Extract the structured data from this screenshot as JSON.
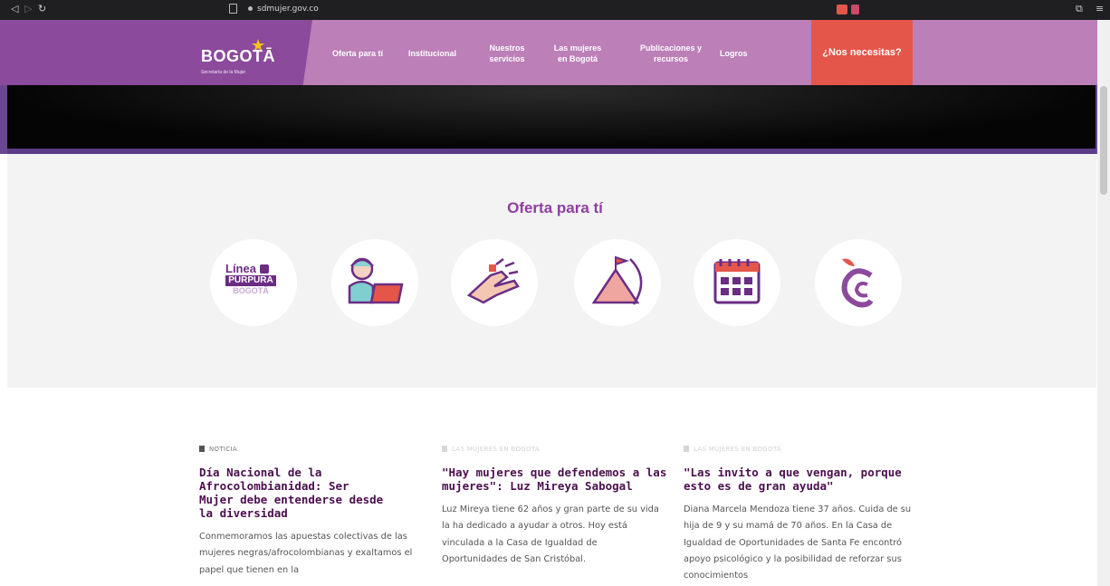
{
  "browser": {
    "url": "sdmujer.gov.co",
    "back_icon": "arrow-left-icon",
    "forward_icon": "arrow-right-icon",
    "reload_icon": "reload-icon"
  },
  "header": {
    "logo_text": "BOGOTĀ",
    "logo_subtext": "Secretaría de la Mujer",
    "nav": [
      {
        "label": "Oferta para tí"
      },
      {
        "label": "Institucional"
      },
      {
        "label": "Nuestros servicios"
      },
      {
        "label": "Las mujeres en Bogotá"
      },
      {
        "label": "Publicaciones y recursos"
      },
      {
        "label": "Logros"
      }
    ],
    "cta": "¿Nos necesitas?",
    "colors": {
      "logo_bg": "#8c4a9c",
      "nav_bg": "#bc7fb8",
      "cta_bg": "#e4564a"
    }
  },
  "offer": {
    "title": "Oferta para tí",
    "linea_purpura": {
      "line1": "Línea",
      "line2": "PÚRPURA",
      "line3": "BOGOTĀ"
    },
    "icons": [
      "linea-purpura-icon",
      "woman-laptop-icon",
      "hands-icon",
      "mountain-flag-icon",
      "calendar-icon",
      "apple-c-icon"
    ]
  },
  "news": [
    {
      "category": "NOTICIA",
      "title": "Día Nacional de la Afrocolombianidad: Ser Mujer debe entenderse desde la diversidad",
      "summary": "Conmemoramos las apuestas colectivas de las mujeres negras/afrocolombianas y exaltamos el papel que tienen en la"
    },
    {
      "category": "LAS MUJERES EN BOGOTÁ",
      "title": "\"Hay mujeres que defendemos a las mujeres\": Luz Mireya Sabogal",
      "summary": "Luz Mireya tiene 62 años y gran parte de su vida la ha dedicado a ayudar a otros. Hoy está vinculada a la Casa de Igualdad de Oportunidades de San Cristóbal."
    },
    {
      "category": "LAS MUJERES EN BOGOTÁ",
      "title": "\"Las invito a que vengan, porque esto es de gran ayuda\"",
      "summary": "Diana Marcela Mendoza tiene 37 años. Cuida de su hija de 9 y su mamá de 70 años. En la Casa de Igualdad de Oportunidades de Santa Fe encontró apoyo psicológico y la posibilidad de reforzar sus conocimientos"
    }
  ]
}
